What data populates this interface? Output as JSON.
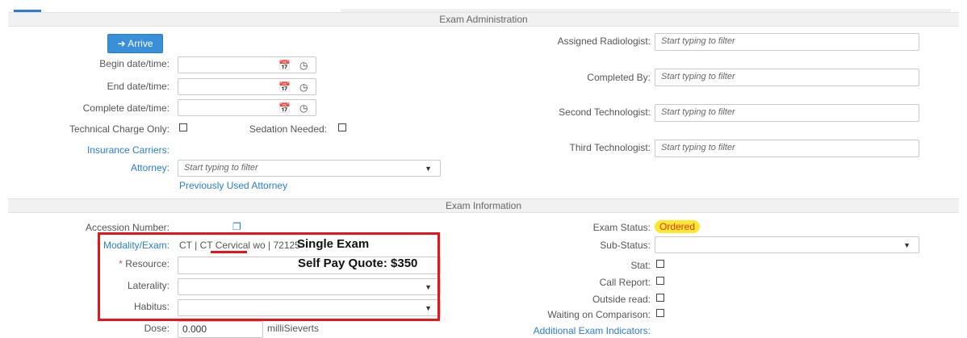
{
  "sections": {
    "exam_administration": "Exam Administration",
    "exam_information": "Exam Information"
  },
  "admin": {
    "arrive_label": "Arrive",
    "begin_label": "Begin date/time:",
    "end_label": "End date/time:",
    "complete_label": "Complete date/time:",
    "technical_charge_label": "Technical Charge Only:",
    "sedation_label": "Sedation Needed:",
    "insurance_label": "Insurance Carriers:",
    "attorney_label": "Attorney:",
    "attorney_placeholder": "Start typing to filter",
    "previous_attorney_label": "Previously Used Attorney",
    "assigned_radiologist_label": "Assigned Radiologist:",
    "completed_by_label": "Completed By:",
    "second_tech_label": "Second Technologist:",
    "third_tech_label": "Third Technologist:",
    "filter_placeholder": "Start typing to filter"
  },
  "info": {
    "accession_label": "Accession Number:",
    "modality_label": "Modality/Exam:",
    "modality_value_pre": "CT | CT ",
    "modality_value_word": "Cervical",
    "modality_value_post": " wo | 72125",
    "resource_label": "Resource:",
    "laterality_label": "Laterality:",
    "habitus_label": "Habitus:",
    "dose_label": "Dose:",
    "dose_value": "0.000",
    "dose_unit": "milliSieverts",
    "exam_status_label": "Exam Status:",
    "exam_status_value": "Ordered",
    "sub_status_label": "Sub-Status:",
    "stat_label": "Stat:",
    "call_report_label": "Call Report:",
    "outside_read_label": "Outside read:",
    "waiting_label": "Waiting on Comparison:",
    "additional_label": "Additional Exam Indicators:"
  },
  "annotation": {
    "line1": "Single Exam",
    "line2": "Self Pay Quote: $350"
  },
  "colors": {
    "accent": "#3a8fd9",
    "link": "#2a7ed2",
    "annotation": "#e8131c",
    "badge": "#ffe830"
  },
  "icons": {
    "arrive": "sign-in-icon",
    "calendar": "calendar-icon",
    "clock": "clock-icon",
    "copy": "copy-icon",
    "dropdown": "chevron-down-icon"
  }
}
